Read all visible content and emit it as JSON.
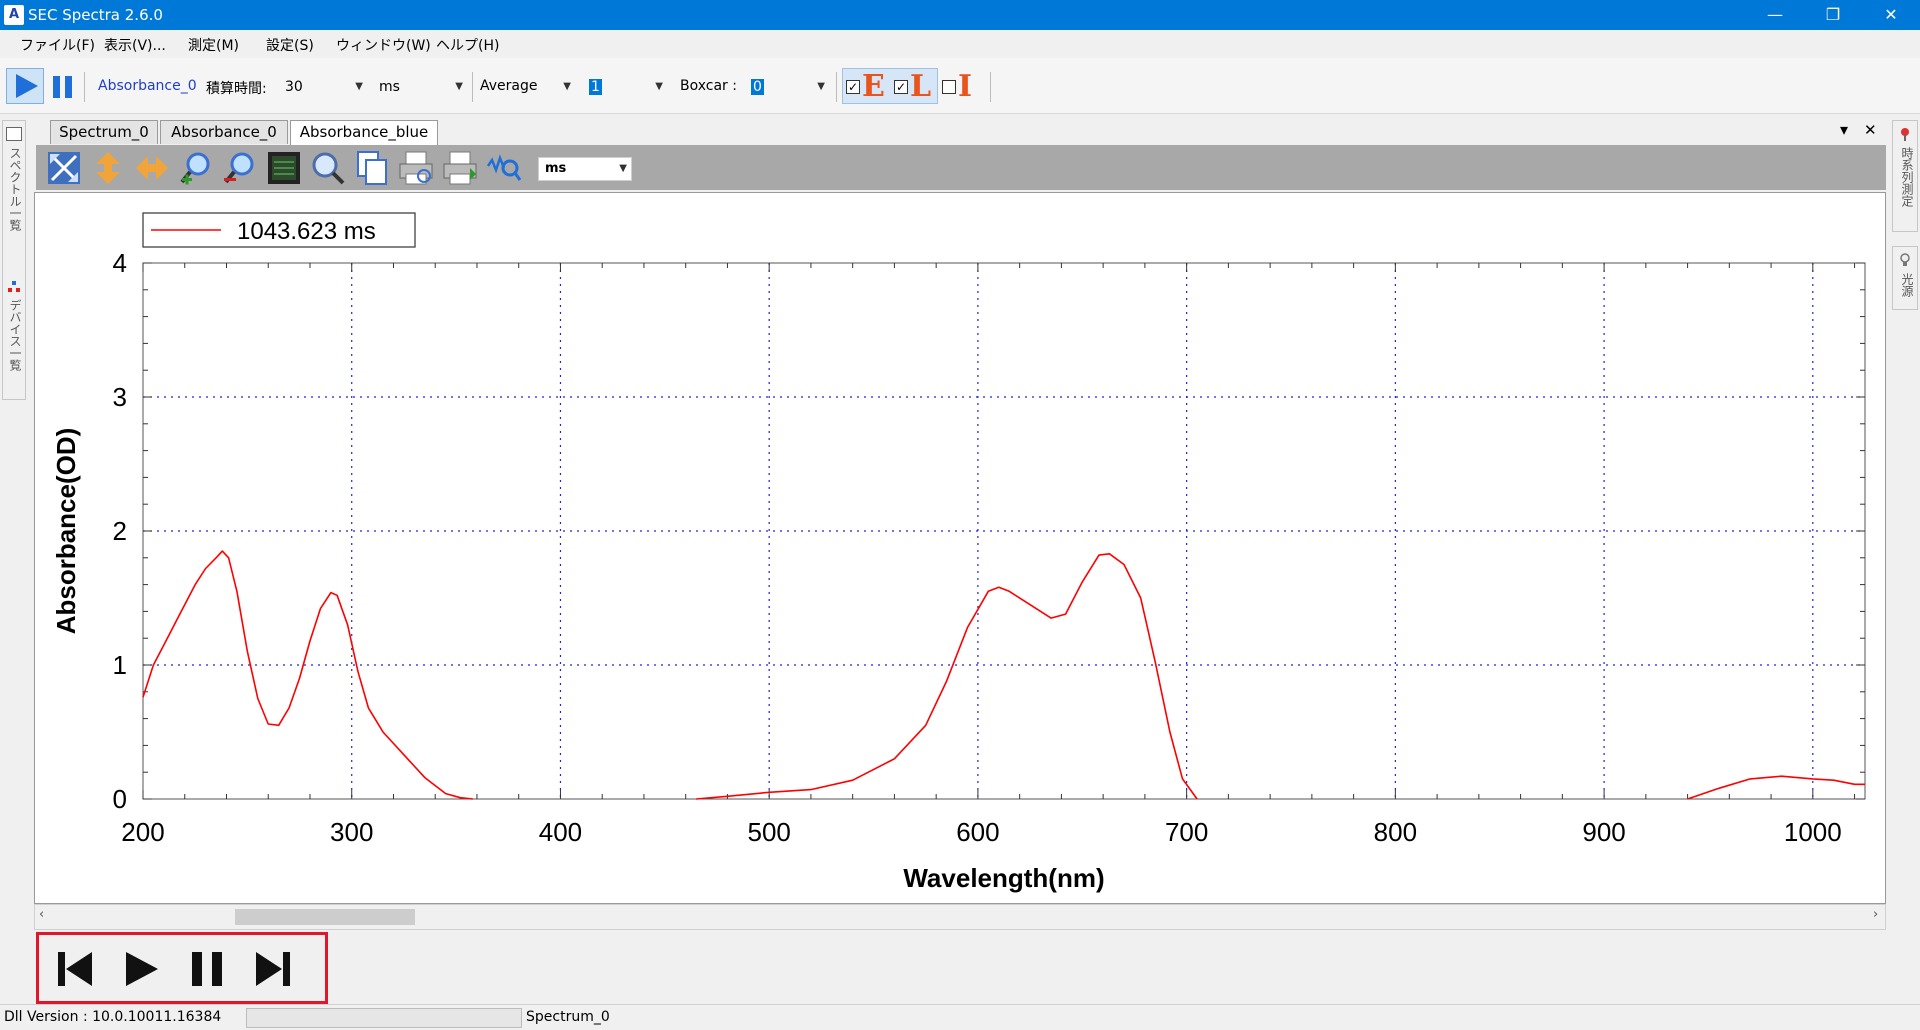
{
  "window": {
    "title": "SEC Spectra 2.6.0",
    "logo": "A",
    "minimize": "—",
    "restore": "❐",
    "close": "✕"
  },
  "menu": [
    "ファイル(F)",
    "表示(V)...",
    "測定(M)",
    "設定(S)",
    "ウィンドウ(W)",
    "ヘルプ(H)"
  ],
  "toolbar": {
    "source": "Absorbance_0",
    "integration_label": "積算時間:",
    "integration_value": "30",
    "unit": "ms",
    "average_label": "Average",
    "average_value": "1",
    "boxcar_label": "Boxcar :",
    "boxcar_value": "0",
    "toggle_e": "E",
    "toggle_l": "L",
    "toggle_i": "I",
    "colors": {
      "play": "#1e6fd9",
      "toggle_e": "#e8541c",
      "toggle_l": "#e8541c",
      "toggle_i": "#e8541c"
    }
  },
  "left_panel": {
    "top_label": "スペクトル一覧",
    "bottom_label": "デバイス一覧"
  },
  "right_panel": {
    "top_label": "時系列測定",
    "bottom_label": "光源"
  },
  "tabs": [
    "Spectrum_0",
    "Absorbance_0",
    "Absorbance_blue"
  ],
  "active_tab": 2,
  "tab_controls": {
    "dropdown": "▾",
    "close": "✕"
  },
  "plot_toolbar": {
    "tools": [
      "fit-all-icon",
      "zoom-vertical-icon",
      "zoom-horizontal-icon",
      "zoom-in-icon",
      "zoom-out-icon",
      "screen-icon",
      "magnifier-icon",
      "copy-icon",
      "print-preview-icon",
      "print-icon",
      "peak-search-icon"
    ],
    "unit_select": "ms"
  },
  "chart_data": {
    "type": "line",
    "xlabel": "Wavelength(nm)",
    "ylabel": "Absorbance(OD)",
    "xlim": [
      200,
      1025
    ],
    "ylim": [
      0,
      4
    ],
    "xticks": [
      200,
      300,
      400,
      500,
      600,
      700,
      800,
      900,
      1000
    ],
    "yticks": [
      0,
      1,
      2,
      3,
      4
    ],
    "grid": true,
    "legend_position": "top-left",
    "series": [
      {
        "name": "1043.623 ms",
        "color": "#ff0000",
        "segments": [
          [
            [
              200,
              0.76
            ],
            [
              205,
              1.0
            ],
            [
              210,
              1.15
            ],
            [
              215,
              1.3
            ],
            [
              220,
              1.45
            ],
            [
              225,
              1.6
            ],
            [
              230,
              1.72
            ],
            [
              235,
              1.8
            ],
            [
              238,
              1.85
            ],
            [
              241,
              1.8
            ],
            [
              245,
              1.55
            ],
            [
              250,
              1.1
            ],
            [
              255,
              0.75
            ],
            [
              260,
              0.56
            ],
            [
              265,
              0.55
            ],
            [
              270,
              0.68
            ],
            [
              275,
              0.9
            ],
            [
              280,
              1.18
            ],
            [
              285,
              1.42
            ],
            [
              290,
              1.54
            ],
            [
              293,
              1.52
            ],
            [
              298,
              1.3
            ],
            [
              303,
              0.95
            ],
            [
              308,
              0.68
            ],
            [
              315,
              0.5
            ],
            [
              325,
              0.33
            ],
            [
              335,
              0.16
            ],
            [
              345,
              0.04
            ],
            [
              352,
              0.01
            ],
            [
              358,
              0.0
            ]
          ],
          [
            [
              465,
              0.0
            ],
            [
              480,
              0.02
            ],
            [
              500,
              0.05
            ],
            [
              520,
              0.07
            ],
            [
              540,
              0.14
            ],
            [
              560,
              0.3
            ],
            [
              575,
              0.55
            ],
            [
              585,
              0.88
            ],
            [
              595,
              1.28
            ],
            [
              605,
              1.55
            ],
            [
              610,
              1.58
            ],
            [
              615,
              1.55
            ],
            [
              625,
              1.45
            ],
            [
              635,
              1.35
            ],
            [
              642,
              1.38
            ],
            [
              650,
              1.62
            ],
            [
              658,
              1.82
            ],
            [
              663,
              1.83
            ],
            [
              670,
              1.75
            ],
            [
              678,
              1.5
            ],
            [
              685,
              1.02
            ],
            [
              692,
              0.5
            ],
            [
              698,
              0.15
            ],
            [
              705,
              0.0
            ]
          ],
          [
            [
              940,
              0.0
            ],
            [
              955,
              0.08
            ],
            [
              970,
              0.15
            ],
            [
              985,
              0.17
            ],
            [
              1000,
              0.15
            ],
            [
              1010,
              0.14
            ],
            [
              1020,
              0.11
            ],
            [
              1025,
              0.11
            ]
          ]
        ]
      }
    ]
  },
  "playback": {
    "buttons": [
      "skip-back",
      "play",
      "pause",
      "skip-forward"
    ]
  },
  "status": {
    "version": "Dll Version : 10.0.10011.16384",
    "spectrum": "Spectrum_0"
  }
}
